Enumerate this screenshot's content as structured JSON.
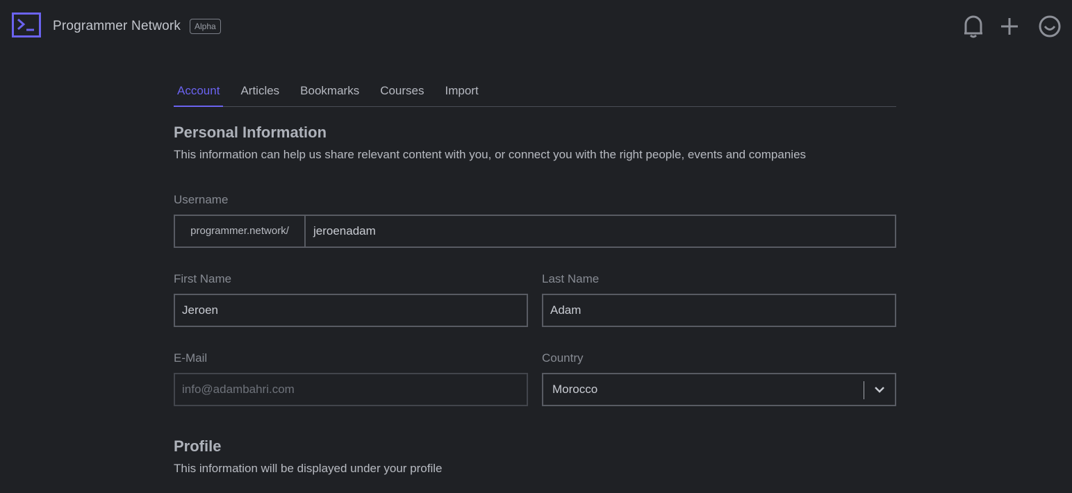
{
  "app": {
    "brand": "Programmer Network",
    "badge": "Alpha",
    "accent": "#6b63f0",
    "icons": [
      "terminal-logo-icon",
      "bell-icon",
      "plus-icon",
      "smiley-avatar-icon"
    ]
  },
  "tabs": [
    {
      "label": "Account",
      "active": true
    },
    {
      "label": "Articles",
      "active": false
    },
    {
      "label": "Bookmarks",
      "active": false
    },
    {
      "label": "Courses",
      "active": false
    },
    {
      "label": "Import",
      "active": false
    }
  ],
  "personal": {
    "title": "Personal Information",
    "description": "This information can help us share relevant content with you, or connect you with the right people, events and companies"
  },
  "form": {
    "username_label": "Username",
    "username_prefix": "programmer.network/",
    "username_value": "jeroenadam",
    "first_name_label": "First Name",
    "first_name_value": "Jeroen",
    "last_name_label": "Last Name",
    "last_name_value": "Adam",
    "email_label": "E-Mail",
    "email_placeholder": "info@adambahri.com",
    "country_label": "Country",
    "country_value": "Morocco"
  },
  "profile": {
    "title": "Profile",
    "description": "This information will be displayed under your profile"
  }
}
